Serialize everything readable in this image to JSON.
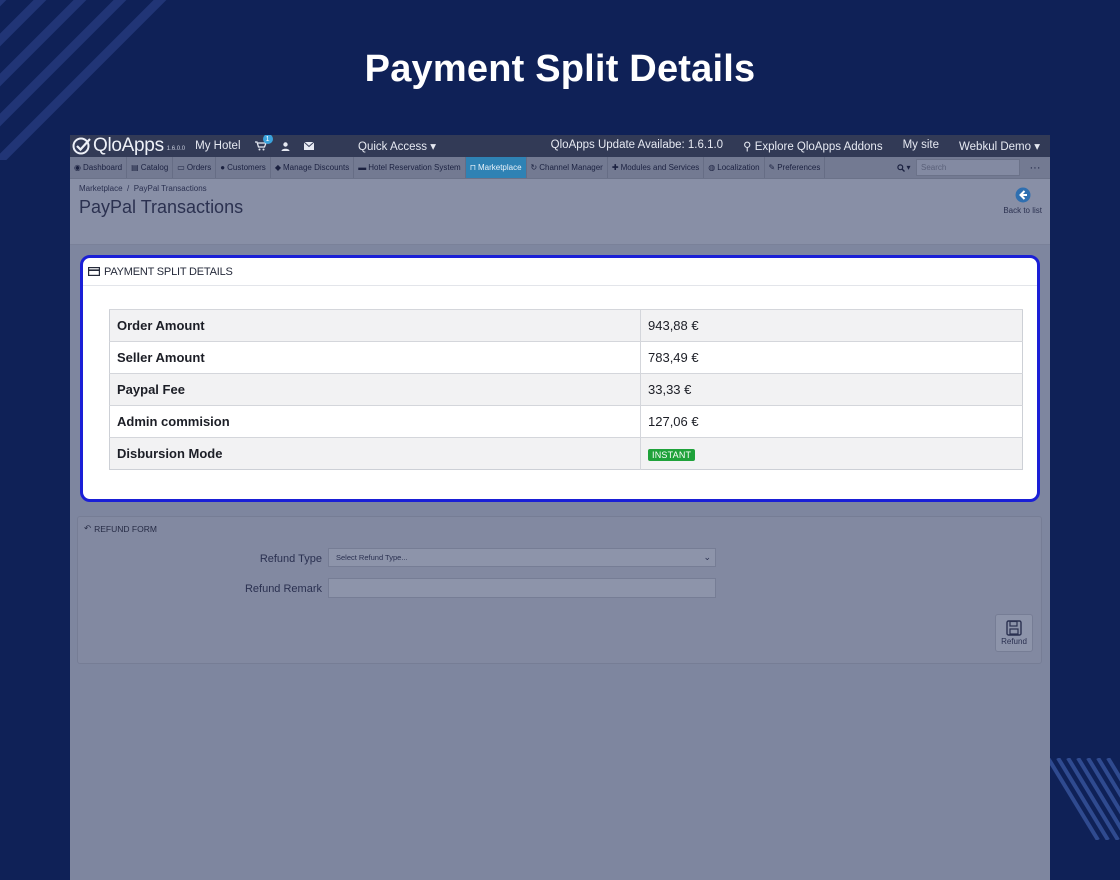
{
  "hero": {
    "title": "Payment Split Details"
  },
  "topbar": {
    "logo_text": "QloApps",
    "logo_version": "1.6.0.0",
    "hotel": "My Hotel",
    "cart_badge": "1",
    "quick_access": "Quick Access",
    "update": "QloApps Update Availabe: 1.6.1.0",
    "addons": "Explore QloApps Addons",
    "mysite": "My site",
    "user": "Webkul Demo"
  },
  "nav": {
    "items": [
      {
        "label": "Dashboard",
        "icon": "dashboard-icon"
      },
      {
        "label": "Catalog",
        "icon": "book-icon"
      },
      {
        "label": "Orders",
        "icon": "credit-card-icon"
      },
      {
        "label": "Customers",
        "icon": "users-icon"
      },
      {
        "label": "Manage Discounts",
        "icon": "tag-icon"
      },
      {
        "label": "Hotel Reservation System",
        "icon": "bed-icon"
      },
      {
        "label": "Marketplace",
        "icon": "cart-icon",
        "active": true
      },
      {
        "label": "Channel Manager",
        "icon": "refresh-icon"
      },
      {
        "label": "Modules and Services",
        "icon": "puzzle-icon"
      },
      {
        "label": "Localization",
        "icon": "globe-icon"
      },
      {
        "label": "Preferences",
        "icon": "wrench-icon"
      }
    ],
    "search_placeholder": "Search"
  },
  "page": {
    "breadcrumb_1": "Marketplace",
    "breadcrumb_sep": "/",
    "breadcrumb_2": "PayPal Transactions",
    "title": "PayPal Transactions",
    "back_label": "Back to list"
  },
  "split_panel": {
    "heading": "PAYMENT SPLIT DETAILS",
    "rows": [
      {
        "label": "Order Amount",
        "value": "943,88 €"
      },
      {
        "label": "Seller Amount",
        "value": "783,49 €"
      },
      {
        "label": "Paypal Fee",
        "value": "33,33 €"
      },
      {
        "label": "Admin commision",
        "value": "127,06 €"
      },
      {
        "label": "Disbursion Mode",
        "value": "INSTANT",
        "badge_color": "#1fa23a"
      }
    ]
  },
  "refund": {
    "heading": "REFUND FORM",
    "type_label": "Refund Type",
    "type_value": "Select Refund Type...",
    "remark_label": "Refund Remark",
    "button_label": "Refund"
  },
  "colors": {
    "background": "#0f2157",
    "highlight_border": "#1a1fd6",
    "active_tab": "#2f82b4"
  }
}
